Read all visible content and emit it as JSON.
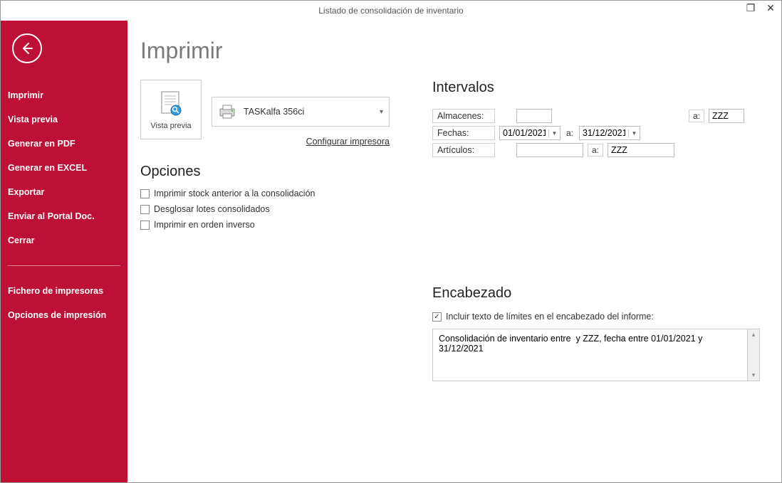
{
  "window": {
    "title": "Listado de consolidación de inventario"
  },
  "sidebar": {
    "items": [
      "Imprimir",
      "Vista previa",
      "Generar en PDF",
      "Generar en EXCEL",
      "Exportar",
      "Enviar al Portal Doc.",
      "Cerrar"
    ],
    "secondary": [
      "Fichero de impresoras",
      "Opciones de impresión"
    ]
  },
  "page": {
    "title": "Imprimir",
    "preview_label": "Vista previa",
    "printer_name": "TASKalfa 356ci",
    "config_printer": "Configurar impresora"
  },
  "options": {
    "heading": "Opciones",
    "stock_anterior": "Imprimir stock anterior a la consolidación",
    "desglosar_lotes": "Desglosar lotes consolidados",
    "orden_inverso": "Imprimir en orden inverso"
  },
  "intervals": {
    "heading": "Intervalos",
    "almacenes_label": "Almacenes:",
    "almacenes_from": "",
    "almacenes_to": "ZZZ",
    "fechas_label": "Fechas:",
    "fechas_from": "01/01/2021",
    "fechas_to": "31/12/2021",
    "articulos_label": "Artículos:",
    "articulos_from": "",
    "articulos_to": "ZZZ",
    "sep": "a:"
  },
  "header": {
    "heading": "Encabezado",
    "include_label": "Incluir texto de límites en el encabezado del informe:",
    "text": "Consolidación de inventario entre  y ZZZ, fecha entre 01/01/2021 y 31/12/2021"
  }
}
